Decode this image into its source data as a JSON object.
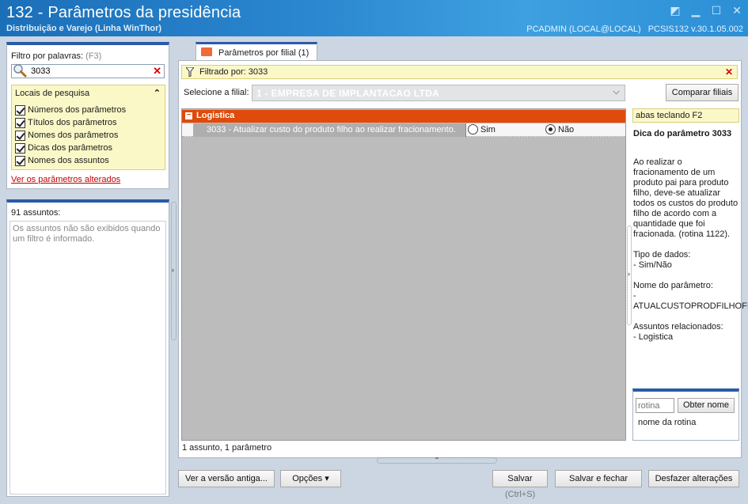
{
  "window": {
    "title": "132 - Parâmetros da presidência",
    "subtitle": "Distribuição e Varejo (Linha WinThor)",
    "user": "PCADMIN (LOCAL@LOCAL)",
    "version": "PCSIS132  v.30.1.05.002"
  },
  "left": {
    "filter_label": "Filtro por palavras:",
    "filter_hint": "(F3)",
    "search_value": "3033",
    "locations_title": "Locais de pesquisa",
    "locations": [
      {
        "label": "Números dos parâmetros",
        "checked": true
      },
      {
        "label": "Títulos dos parâmetros",
        "checked": true
      },
      {
        "label": "Nomes dos parâmetros",
        "checked": true
      },
      {
        "label": "Dicas dos parâmetros",
        "checked": true
      },
      {
        "label": "Nomes dos assuntos",
        "checked": true
      }
    ],
    "changed_link": "Ver os parâmetros alterados",
    "subjects_count": "91 assuntos:",
    "subjects_msg": "Os assuntos não são exibidos quando um filtro é informado."
  },
  "main": {
    "tab_label": "Parâmetros por filial  (1)",
    "filtered_by": "Filtrado por: 3033",
    "branch_label": "Selecione a filial:",
    "branch_value": "1 - EMPRESA DE IMPLANTACAO LTDA",
    "compare_button": "Comparar filiais",
    "group_name": "Logistica",
    "parameter": {
      "text": "3033 - Atualizar custo do produto filho ao realizar fracionamento.",
      "option_yes": "Sim",
      "option_no": "Não",
      "selected": "Não"
    },
    "status": "1 assunto, 1 parâmetro"
  },
  "tip": {
    "hint": "abas teclando F2",
    "title": "Dica do parâmetro 3033",
    "body": "Ao realizar o fracionamento de um produto pai para produto filho, deve-se atualizar todos os custos do produto filho de acordo com a quantidade que foi fracionada. (rotina 1122).\n\nTipo de dados:\n  - Sim/Não\n\nNome do parâmetro:\n  - ATUALCUSTOPRODFILHOFI\n\nAssuntos relacionados:\n  - Logistica",
    "rotina_placeholder": "rotina",
    "obter_button": "Obter nome",
    "nome_label": "nome da rotina"
  },
  "footer": {
    "old_version_button": "Ver a versão antiga...",
    "options_button": "Opções ▾",
    "save_button": "Salvar",
    "save_shortcut": "(Ctrl+S)",
    "save_close_button": "Salvar e fechar",
    "undo_button": "Desfazer alterações"
  }
}
